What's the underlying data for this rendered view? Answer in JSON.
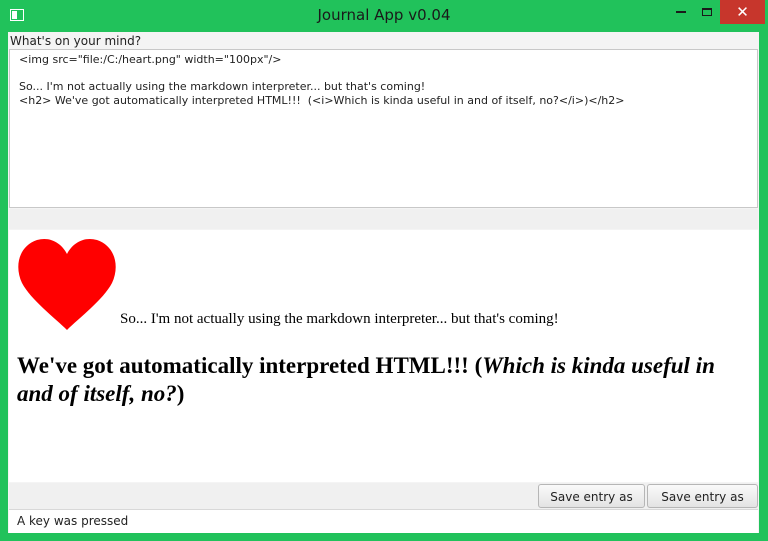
{
  "window": {
    "title": "Journal App v0.04",
    "close_glyph": "✕"
  },
  "editor": {
    "label": "What's on your mind?",
    "lines": [
      "<img src=\"file:/C:/heart.png\" width=\"100px\"/>",
      "",
      "So... I'm not actually using the markdown interpreter... but that's coming!",
      "<h2> We've got automatically interpreted HTML!!!  (<i>Which is kinda useful in and of itself, no?</i>)</h2>"
    ]
  },
  "preview": {
    "image_icon": "heart-icon",
    "heart_color": "#ff0000",
    "paragraph": "So... I'm not actually using the markdown interpreter... but that's coming!",
    "heading_plain": "We've got automatically interpreted HTML!!! (",
    "heading_italic": "Which is kinda useful in and of itself, no?",
    "heading_close": ")"
  },
  "actions": {
    "save_text": "Save entry as text",
    "save_html": "Save entry as html"
  },
  "status": {
    "message": "A key was pressed"
  },
  "colors": {
    "window_frame": "#21c25b",
    "close_button": "#c7362c"
  }
}
